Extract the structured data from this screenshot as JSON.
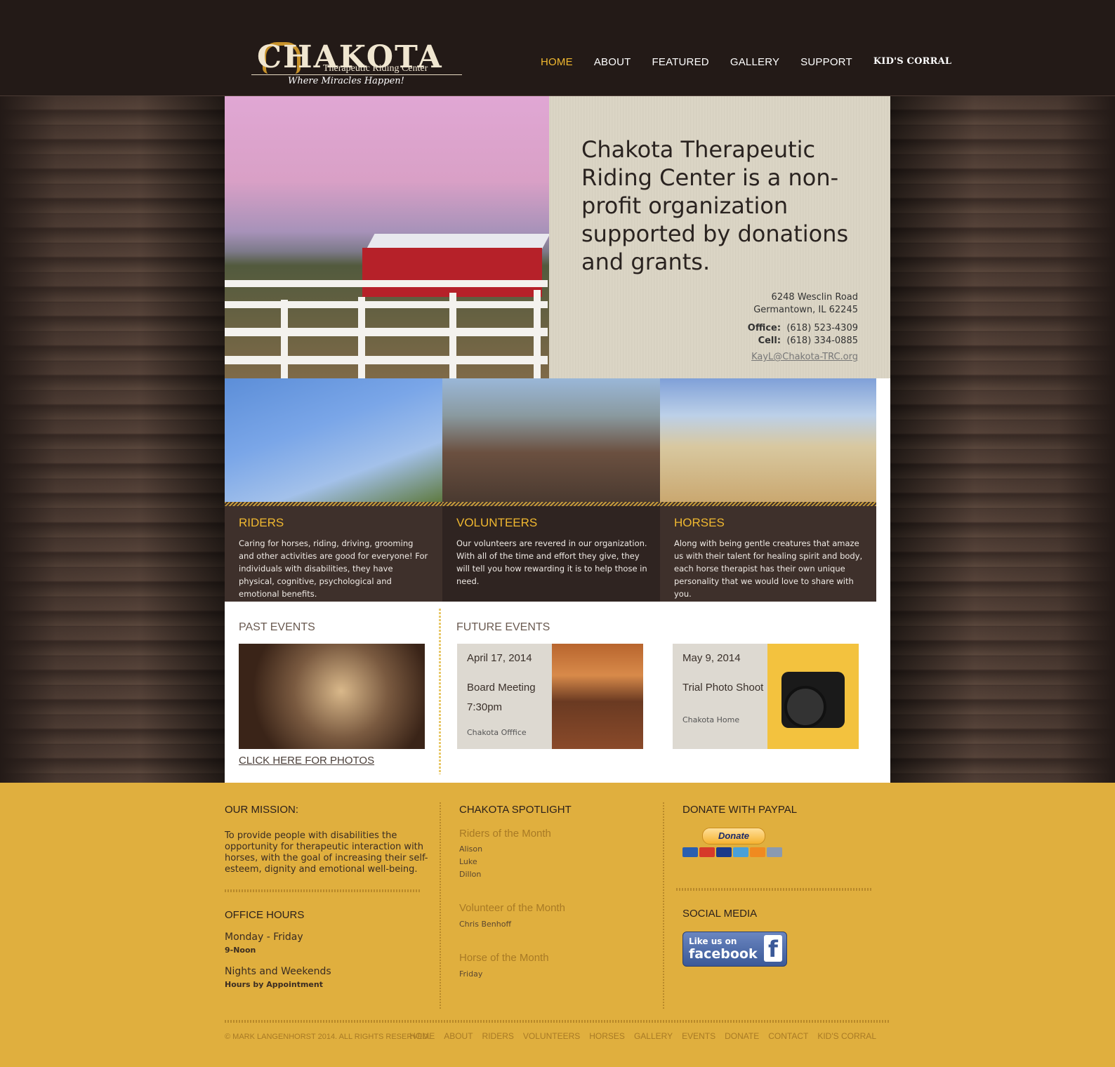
{
  "logo": {
    "name": "CHAKOTA",
    "subtitle": "Therapeutic Riding Center",
    "tagline": "Where Miracles Happen!"
  },
  "nav": [
    {
      "label": "HOME",
      "active": true
    },
    {
      "label": "ABOUT"
    },
    {
      "label": "FEATURED"
    },
    {
      "label": "GALLERY"
    },
    {
      "label": "SUPPORT"
    },
    {
      "label": "KID'S CORRAL"
    }
  ],
  "intro": {
    "headline": "Chakota Therapeutic Riding Center is a non-profit organization supported by donations and grants.",
    "address_line1": "6248 Wesclin Road",
    "address_line2": "Germantown, IL 62245",
    "office_label": "Office:",
    "office_phone": "(618) 523-4309",
    "cell_label": "Cell:",
    "cell_phone": "(618) 334-0885",
    "email": "KayL@Chakota-TRC.org"
  },
  "cards": [
    {
      "title": "RIDERS",
      "text": "Caring for horses, riding, driving, grooming and other activities are good for everyone! For individuals with disabilities, they have physical, cognitive, psychological and emotional benefits."
    },
    {
      "title": "VOLUNTEERS",
      "text": "Our volunteers are revered in our organization. With all of the time and effort they give, they will tell you how rewarding it is to help those in need."
    },
    {
      "title": "HORSES",
      "text": "Along with being gentle creatures that amaze us with their talent for healing spirit and body, each horse therapist has their own unique personality that we would love to share with you."
    }
  ],
  "events": {
    "past_heading": "PAST EVENTS",
    "past_link": "CLICK HERE FOR PHOTOS",
    "future_heading": "FUTURE EVENTS",
    "future": [
      {
        "date": "April 17, 2014",
        "title": "Board Meeting",
        "time": "7:30pm",
        "place": "Chakota Offfice"
      },
      {
        "date": "May 9, 2014",
        "title": "Trial Photo Shoot",
        "time": "",
        "place": "Chakota Home"
      }
    ]
  },
  "footer": {
    "mission_heading": "OUR MISSION:",
    "mission_text": "To provide people with disabilities the opportunity for therapeutic interaction with horses, with the goal of increasing their self-esteem, dignity and emotional well-being.",
    "hours_heading": "OFFICE HOURS",
    "hours": [
      {
        "days": "Monday - Friday",
        "detail": "9-Noon"
      },
      {
        "days": "Nights and Weekends",
        "detail": "Hours by Appointment"
      }
    ],
    "spotlight_heading": "CHAKOTA SPOTLIGHT",
    "spotlight": [
      {
        "heading": "Riders of the Month",
        "names": [
          "Alison",
          "Luke",
          "Dillon"
        ]
      },
      {
        "heading": "Volunteer of the Month",
        "names": [
          "Chris Benhoff"
        ]
      },
      {
        "heading": "Horse of the Month",
        "names": [
          "Friday"
        ]
      }
    ],
    "donate_heading": "DONATE WITH PAYPAL",
    "donate_button": "Donate",
    "social_heading": "SOCIAL MEDIA",
    "facebook_like": "Like us on",
    "facebook_name": "facebook",
    "copyright": "© MARK LANGENHORST 2014. ALL RIGHTS RESERVED.",
    "links": [
      "HOME",
      "ABOUT",
      "RIDERS",
      "VOLUNTEERS",
      "HORSES",
      "GALLERY",
      "EVENTS",
      "DONATE",
      "CONTACT",
      "KID'S CORRAL"
    ]
  }
}
